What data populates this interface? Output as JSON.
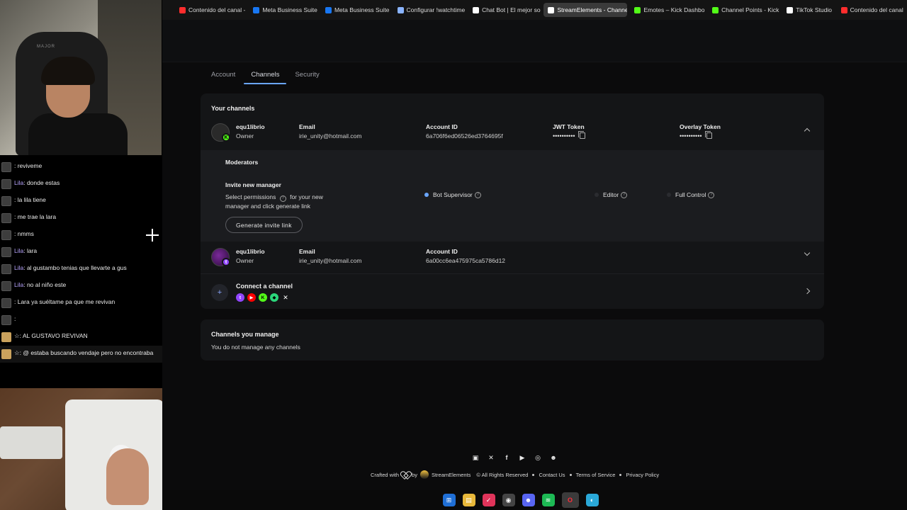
{
  "browser_tabs": [
    {
      "label": "Contenido del canal -",
      "color": "#ff2d2d"
    },
    {
      "label": "Meta Business Suite",
      "color": "#1877f2"
    },
    {
      "label": "Meta Business Suite",
      "color": "#1877f2"
    },
    {
      "label": "Configurar !watchtime",
      "color": "#8ab4ff"
    },
    {
      "label": "Chat Bot | El mejor so",
      "color": "#ffffff"
    },
    {
      "label": "StreamElements - Channe",
      "color": "#ffffff",
      "active": true
    },
    {
      "label": "Emotes – Kick Dashbo",
      "color": "#53fc18"
    },
    {
      "label": "Channel Points - Kick",
      "color": "#53fc18"
    },
    {
      "label": "TikTok Studio",
      "color": "#ffffff"
    },
    {
      "label": "Contenido del canal",
      "color": "#ff2d2d"
    }
  ],
  "chat": [
    {
      "user": "",
      "msg": ": reviveme",
      "avatar": "gray"
    },
    {
      "user": "Lila",
      "msg": ": donde estas",
      "avatar": "gray"
    },
    {
      "user": "",
      "msg": ": la lila tiene",
      "avatar": "gray"
    },
    {
      "user": "",
      "msg": ": me trae la lara",
      "avatar": "gray"
    },
    {
      "user": "",
      "msg": ": nmms",
      "avatar": "gray"
    },
    {
      "user": "Lila",
      "msg": ": lara",
      "avatar": "gray"
    },
    {
      "user": "Lila",
      "msg": ": al gustambo tenias que llevarte a gus",
      "avatar": "gray"
    },
    {
      "user": "Lila",
      "msg": ": no al niño este",
      "avatar": "gray"
    },
    {
      "user": "",
      "msg": ": Lara ya suéltame pa que me revivan",
      "avatar": "gray"
    },
    {
      "user": "",
      "msg": ":",
      "avatar": "gray"
    },
    {
      "user": "",
      "msg": "☆: AL GUSTAVO REVIVAN",
      "avatar": "gold"
    },
    {
      "user": "",
      "msg": "☆: @ estaba buscando vendaje pero no encontraba",
      "avatar": "gold"
    }
  ],
  "overlay": {
    "chair_brand": "MAJOR"
  },
  "settings_tabs": {
    "account": "Account",
    "channels": "Channels",
    "security": "Security"
  },
  "your_channels": {
    "title": "Your channels",
    "channel1": {
      "name": "equ1librio",
      "role": "Owner",
      "email_label": "Email",
      "email": "irie_unity@hotmail.com",
      "account_id_label": "Account ID",
      "account_id": "6a706f6ed06526ed3764695f",
      "jwt_label": "JWT Token",
      "jwt_value": "••••••••••",
      "overlay_label": "Overlay Token",
      "overlay_value": "••••••••••",
      "platform": "kick"
    },
    "moderators": {
      "title": "Moderators",
      "invite_title": "Invite new manager",
      "invite_desc_1": "Select permissions",
      "invite_desc_2": "for your new manager and click generate link",
      "button": "Generate invite link",
      "permissions": [
        "Bot Supervisor",
        "Editor",
        "Full Control"
      ],
      "selected": "Bot Supervisor"
    },
    "channel2": {
      "name": "equ1librio",
      "role": "Owner",
      "email_label": "Email",
      "email": "irie_unity@hotmail.com",
      "account_id_label": "Account ID",
      "account_id": "6a00cc6ea475975ca5786d12",
      "platform": "twitch"
    },
    "connect": {
      "title": "Connect a channel",
      "plus": "+"
    }
  },
  "channels_manage": {
    "title": "Channels you manage",
    "empty": "You do not manage any channels"
  },
  "footer": {
    "crafted": "Crafted with",
    "by": "by",
    "brand": "StreamElements",
    "rights": "© All Rights Reserved",
    "contact": "Contact Us",
    "terms": "Terms of Service",
    "privacy": "Privacy Policy"
  },
  "colors": {
    "accent": "#6aa6ff",
    "kick": "#53fc18",
    "twitch": "#9146ff",
    "youtube": "#ff0000"
  }
}
